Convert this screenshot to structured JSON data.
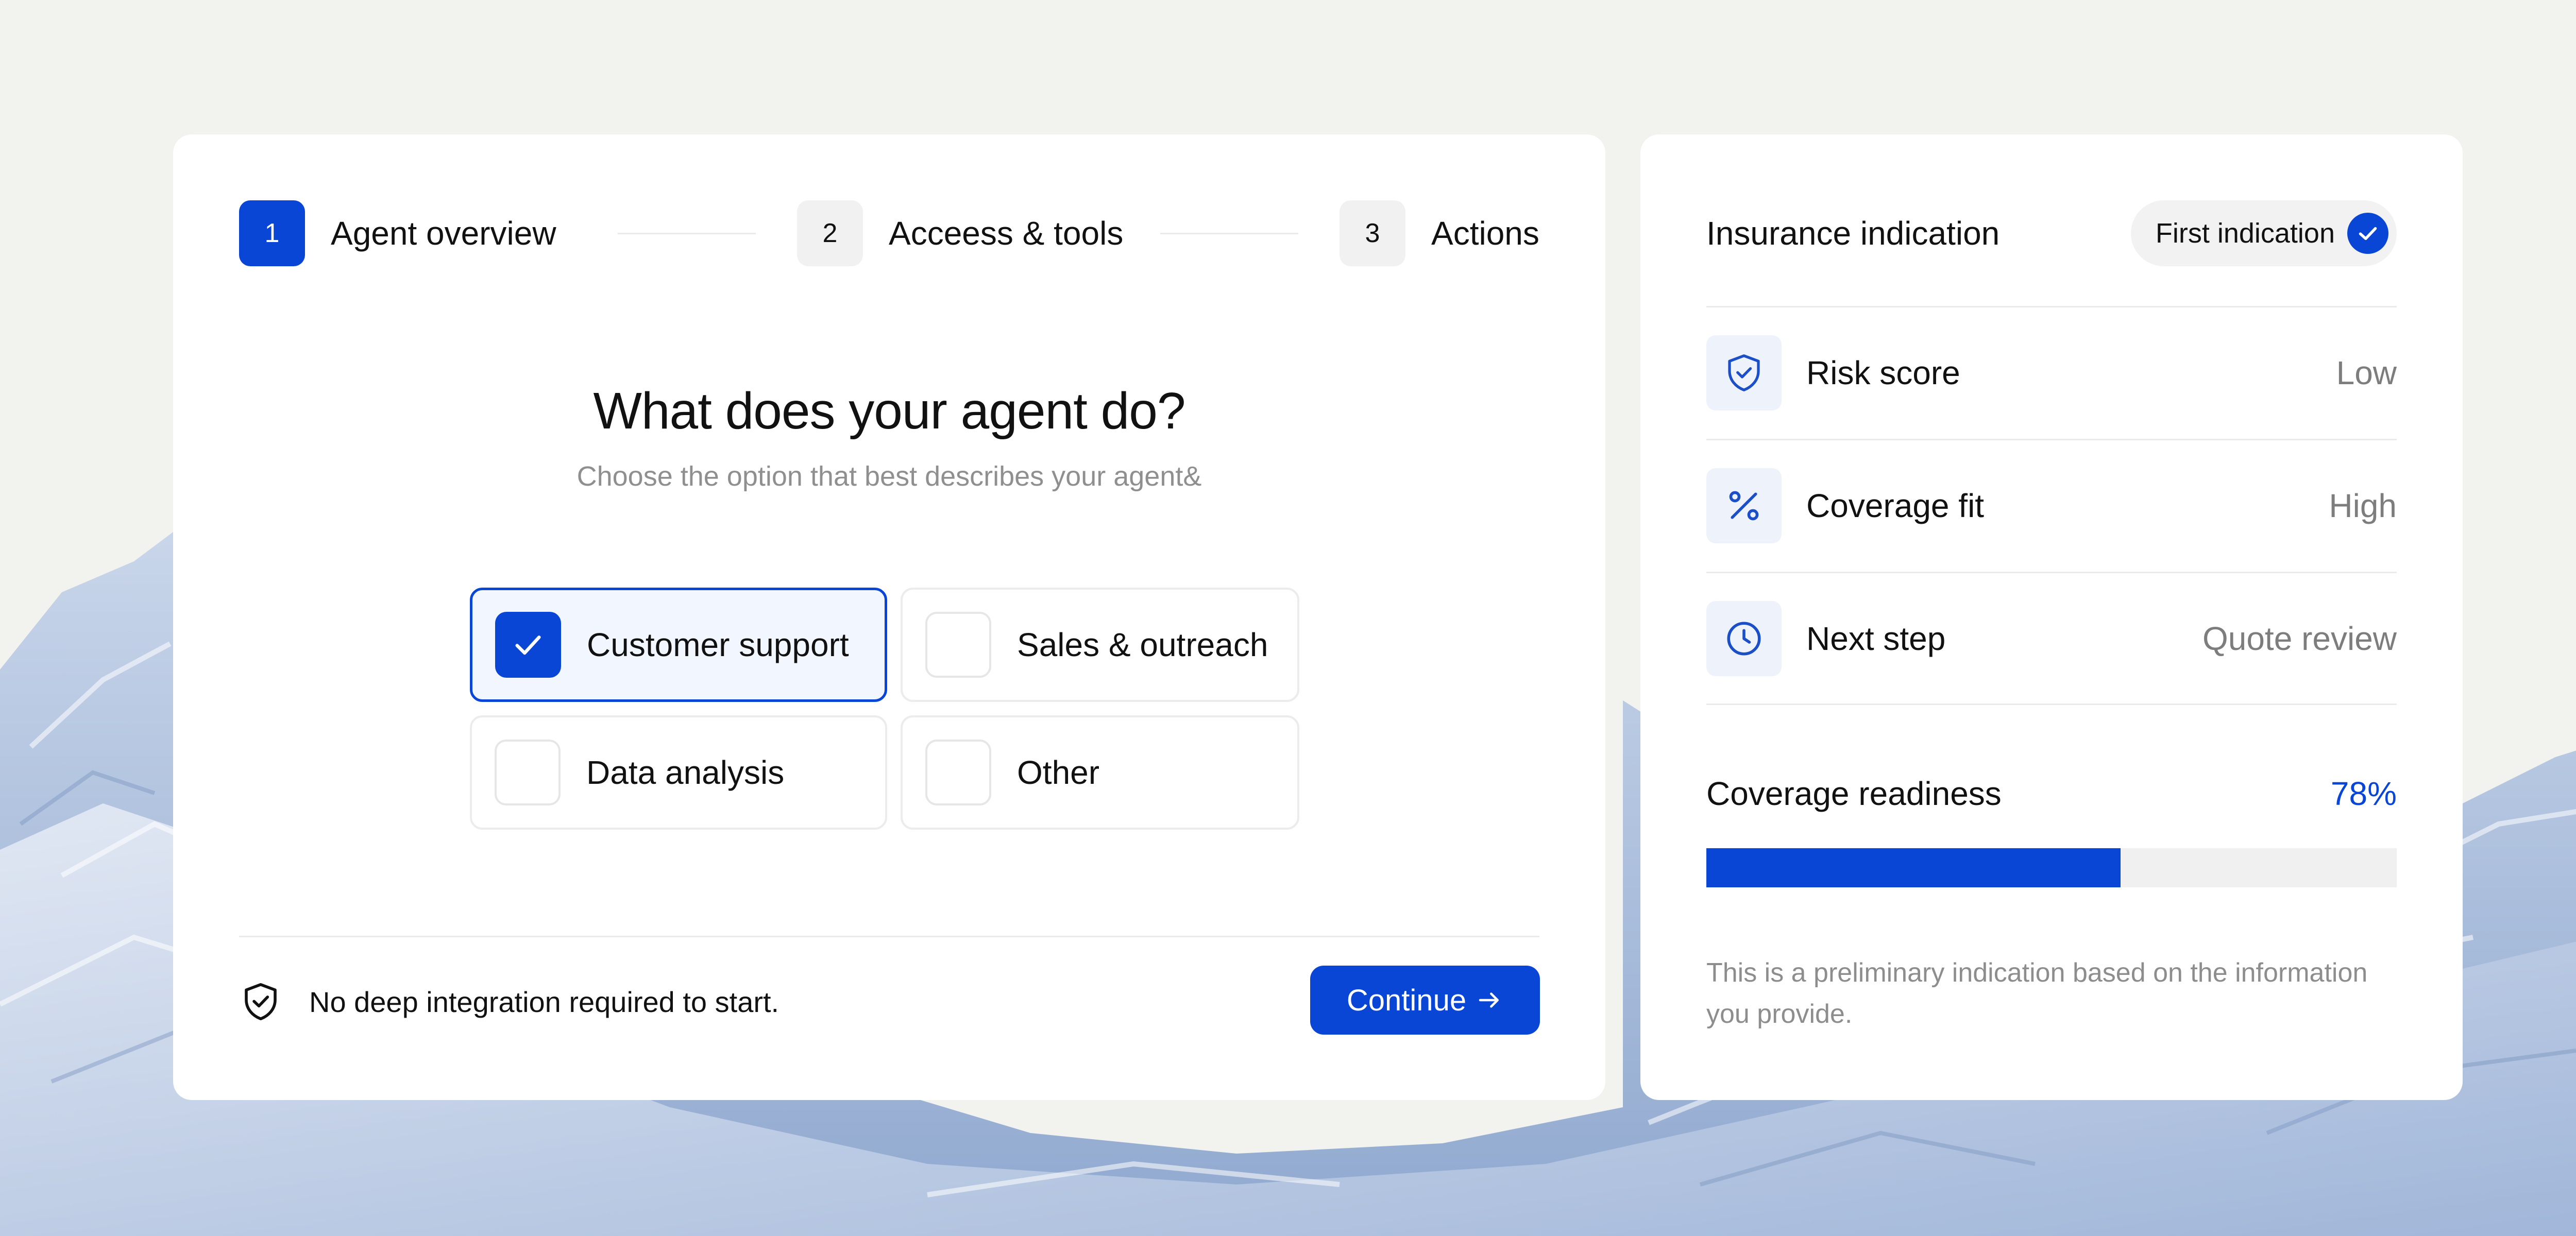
{
  "stepper": {
    "steps": [
      {
        "number": "1",
        "label": "Agent overview",
        "active": true
      },
      {
        "number": "2",
        "label": "Acceess & tools",
        "active": false
      },
      {
        "number": "3",
        "label": "Actions",
        "active": false
      }
    ]
  },
  "question": {
    "title": "What does your agent do?",
    "subtitle": "Choose the option that best describes your agent&"
  },
  "options": [
    {
      "label": "Customer support",
      "selected": true
    },
    {
      "label": "Sales & outreach",
      "selected": false
    },
    {
      "label": "Data analysis",
      "selected": false
    },
    {
      "label": "Other",
      "selected": false
    }
  ],
  "footer": {
    "note": "No deep integration required to start.",
    "note_icon": "shield-check-icon",
    "continue_label": "Continue",
    "continue_icon": "arrow-right-icon"
  },
  "insurance": {
    "title": "Insurance indication",
    "badge_label": "First indication",
    "badge_icon": "check-circle-icon",
    "metrics": [
      {
        "icon": "shield-check-icon",
        "label": "Risk score",
        "value": "Low"
      },
      {
        "icon": "percent-icon",
        "label": "Coverage fit",
        "value": "High"
      },
      {
        "icon": "clock-icon",
        "label": "Next step",
        "value": "Quote review"
      }
    ],
    "readiness_label": "Coverage readiness",
    "readiness_value": "78%",
    "readiness_bar_fill": 0.6,
    "disclaimer": "This is a preliminary indication based on the information you provide."
  },
  "colors": {
    "accent": "#0a46d6",
    "background": "#f2f2ef",
    "card": "#ffffff",
    "muted_text": "#8f8f8f"
  }
}
